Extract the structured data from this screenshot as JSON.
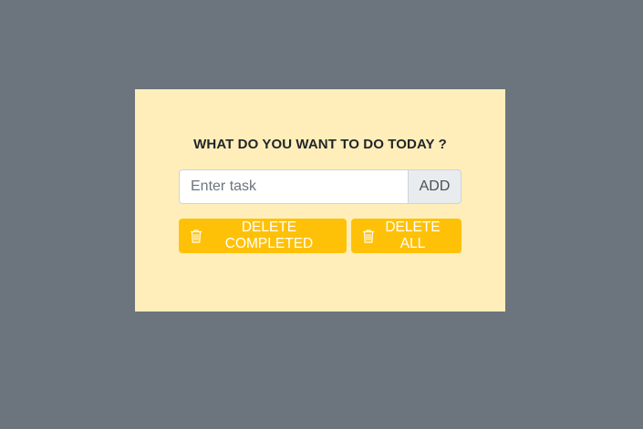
{
  "colors": {
    "background": "#6c757d",
    "card": "#ffeeba",
    "warning": "#ffc107",
    "add_button": "#e9ecef"
  },
  "card": {
    "title": "WHAT DO YOU WANT TO DO TODAY ?"
  },
  "task_form": {
    "input_value": "",
    "input_placeholder": "Enter task",
    "add_label": "ADD"
  },
  "actions": {
    "delete_completed_label": "DELETE COMPLETED",
    "delete_completed_icon": "trash-icon",
    "delete_all_label": "DELETE ALL",
    "delete_all_icon": "trash-icon"
  }
}
